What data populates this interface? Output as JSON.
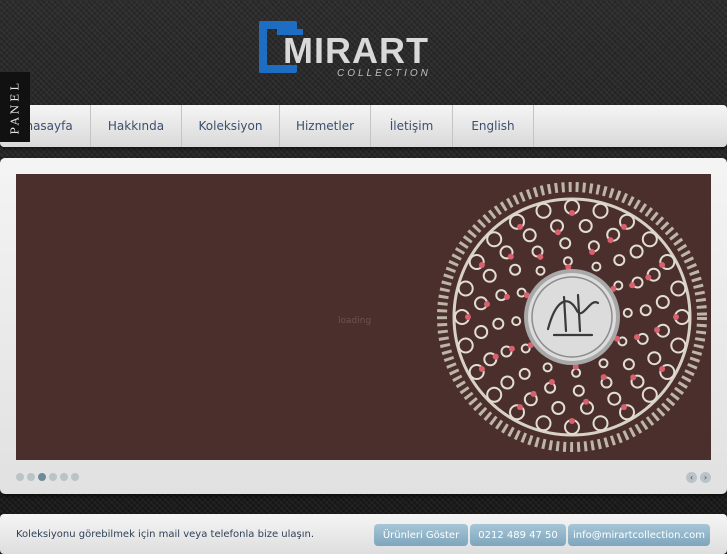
{
  "logo": {
    "name": "MIRART",
    "sub": "COLLECTION"
  },
  "panel_tab": {
    "label": "PANEL"
  },
  "nav": {
    "items": [
      {
        "label": "Anasayfa"
      },
      {
        "label": "Hakkında"
      },
      {
        "label": "Koleksiyon"
      },
      {
        "label": "Hizmetler"
      },
      {
        "label": "İletişim"
      },
      {
        "label": "English"
      }
    ]
  },
  "slider": {
    "loading_text": "loading",
    "dot_count": 6,
    "active_dot": 3
  },
  "footer": {
    "text": "Koleksiyonu görebilmek için mail veya telefonla bize ulaşın.",
    "show_products_label": "Ürünleri Göster",
    "phone": "0212 489 47 50",
    "email": "info@mirartcollection.com"
  },
  "colors": {
    "accent_blue": "#1d6ec2",
    "slide_bg": "#4b2f2d",
    "nav_text": "#3c4f6e",
    "button_bg": "#8fb3c8"
  }
}
